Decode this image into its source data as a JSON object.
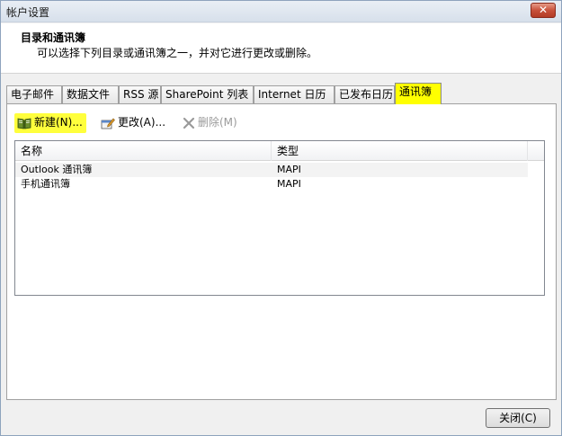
{
  "window": {
    "title": "帐户设置",
    "close_glyph": "✕"
  },
  "header": {
    "title": "目录和通讯簿",
    "description": "可以选择下列目录或通讯簿之一，并对它进行更改或删除。"
  },
  "tabs": [
    {
      "label": "电子邮件"
    },
    {
      "label": "数据文件"
    },
    {
      "label": "RSS 源"
    },
    {
      "label": "SharePoint 列表"
    },
    {
      "label": "Internet 日历"
    },
    {
      "label": "已发布日历"
    },
    {
      "label": "通讯簿",
      "active": true
    }
  ],
  "toolbar": {
    "new_label": "新建(N)...",
    "new_icon": "book-icon",
    "edit_label": "更改(A)...",
    "edit_icon": "edit-icon",
    "delete_label": "删除(M)",
    "delete_icon": "delete-x-icon"
  },
  "list": {
    "columns": [
      "名称",
      "类型"
    ],
    "rows": [
      {
        "name": "Outlook 通讯簿",
        "type": "MAPI"
      },
      {
        "name": "手机通讯簿",
        "type": "MAPI"
      }
    ]
  },
  "footer": {
    "close_label": "关闭(C)"
  },
  "colors": {
    "highlight": "#ffff00",
    "title_close": "#c8513b"
  }
}
